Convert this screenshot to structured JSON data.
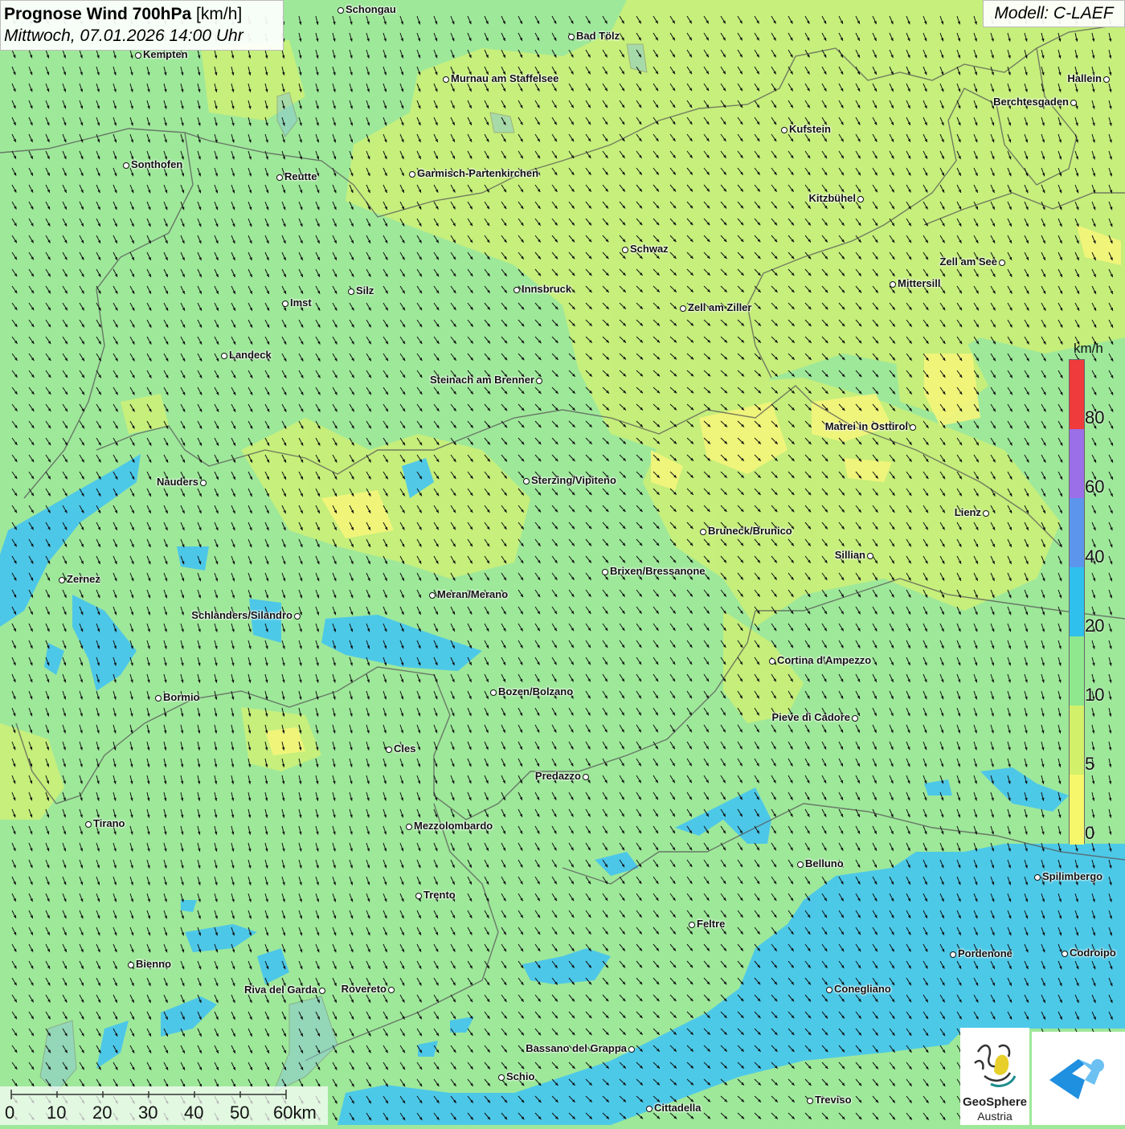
{
  "title": {
    "main": "Prognose Wind 700hPa",
    "unit": "[km/h]",
    "datetime": "Mittwoch, 07.01.2026 14:00 Uhr"
  },
  "model": "Modell: C-LAEF",
  "legend": {
    "unit": "km/h",
    "labels": [
      "80",
      "60",
      "40",
      "20",
      "10",
      "5",
      "0"
    ],
    "colors": [
      "#ef3b3b",
      "#9b6fe8",
      "#5b96ec",
      "#2fc0ee",
      "#8fe88e",
      "#d2f06a",
      "#f7f76c"
    ]
  },
  "scale": {
    "labels": [
      "0",
      "10",
      "20",
      "30",
      "40",
      "50",
      "60km"
    ]
  },
  "logo": {
    "name": "GeoSphere",
    "sub": "Austria"
  },
  "cities": [
    {
      "name": "Schongau"
    },
    {
      "name": "Bad Tölz"
    },
    {
      "name": "Kempten"
    },
    {
      "name": "Murnau am Staffelsee"
    },
    {
      "name": "Hallein"
    },
    {
      "name": "Berchtesgaden"
    },
    {
      "name": "Kufstein"
    },
    {
      "name": "Sonthofen"
    },
    {
      "name": "Reutte"
    },
    {
      "name": "Garmisch-Partenkirchen"
    },
    {
      "name": "Kitzbühel"
    },
    {
      "name": "Schwaz"
    },
    {
      "name": "Zell am See"
    },
    {
      "name": "Mittersill"
    },
    {
      "name": "Innsbruck"
    },
    {
      "name": "Silz"
    },
    {
      "name": "Imst"
    },
    {
      "name": "Zell am Ziller"
    },
    {
      "name": "Landeck"
    },
    {
      "name": "Steinach am Brenner"
    },
    {
      "name": "Matrei in Osttirol"
    },
    {
      "name": "Nauders"
    },
    {
      "name": "Sterzing/Vipiteno"
    },
    {
      "name": "Lienz"
    },
    {
      "name": "Bruneck/Brunico"
    },
    {
      "name": "Sillian"
    },
    {
      "name": "Zernez"
    },
    {
      "name": "Brixen/Bressanone"
    },
    {
      "name": "Meran/Merano"
    },
    {
      "name": "Schlanders/Silandro"
    },
    {
      "name": "Cortina d'Ampezzo"
    },
    {
      "name": "Bozen/Bolzano"
    },
    {
      "name": "Bormio"
    },
    {
      "name": "Pieve di Cadore"
    },
    {
      "name": "Cles"
    },
    {
      "name": "Predazzo"
    },
    {
      "name": "Tirano"
    },
    {
      "name": "Mezzolombardo"
    },
    {
      "name": "Belluno"
    },
    {
      "name": "Spilimbergo"
    },
    {
      "name": "Trento"
    },
    {
      "name": "Feltre"
    },
    {
      "name": "Bienno"
    },
    {
      "name": "Pordenone"
    },
    {
      "name": "Codroipo"
    },
    {
      "name": "Riva del Garda"
    },
    {
      "name": "Rovereto"
    },
    {
      "name": "Conegliano"
    },
    {
      "name": "Bassano del Grappa"
    },
    {
      "name": "Schio"
    },
    {
      "name": "Treviso"
    },
    {
      "name": "Cittadella"
    }
  ]
}
